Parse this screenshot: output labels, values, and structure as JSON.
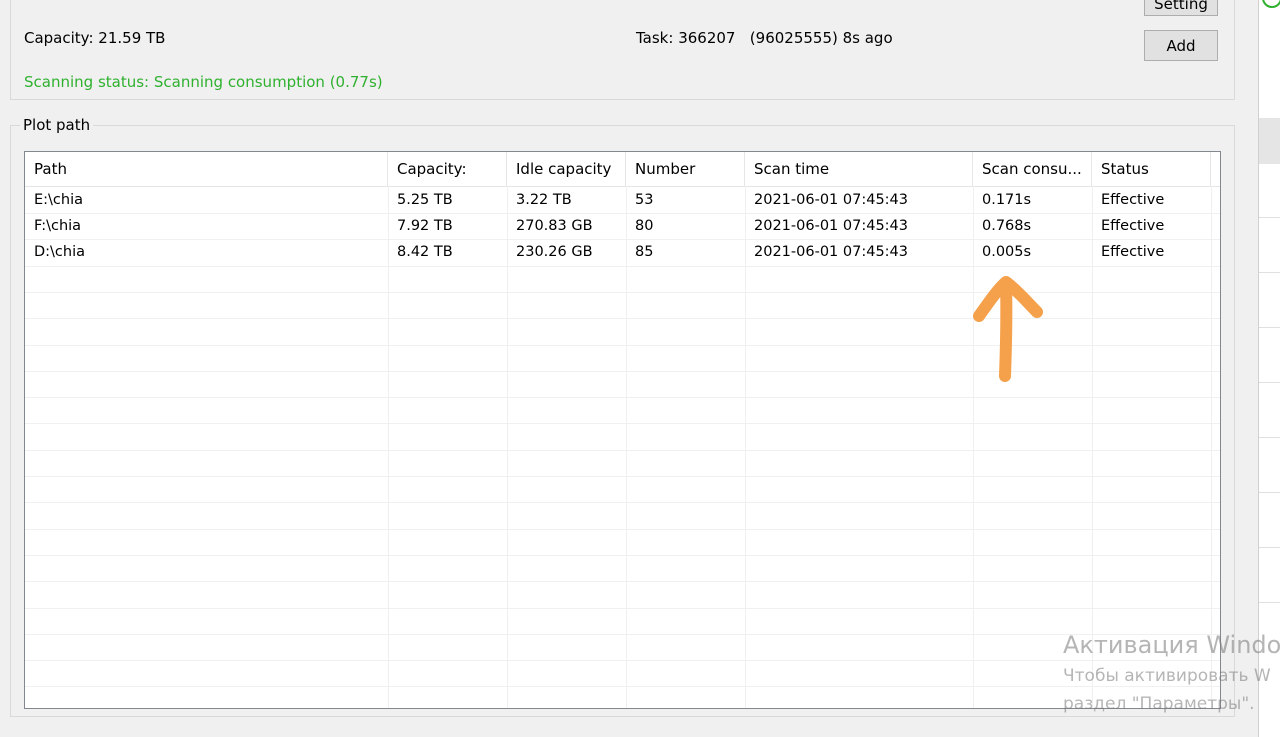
{
  "header": {
    "capacity_label": "Capacity:",
    "capacity_value": "21.59 TB",
    "task_label": "Task:",
    "task_value": "366207",
    "task_detail": "(96025555) 8s ago",
    "scan_status_label": "Scanning status:",
    "scan_status_value": "Scanning consumption (0.77s)",
    "status_color": "#2fb12f"
  },
  "buttons": {
    "setting_label": "Setting",
    "add_label": "Add"
  },
  "plot_path": {
    "group_title": "Plot path",
    "columns": [
      "Path",
      "Capacity:",
      "Idle capacity",
      "Number",
      "Scan time",
      "Scan consu...",
      "Status"
    ],
    "rows": [
      [
        "E:\\chia",
        "5.25 TB",
        "3.22 TB",
        "53",
        "2021-06-01 07:45:43",
        "0.171s",
        "Effective"
      ],
      [
        "F:\\chia",
        "7.92 TB",
        "270.83 GB",
        "80",
        "2021-06-01 07:45:43",
        "0.768s",
        "Effective"
      ],
      [
        "D:\\chia",
        "8.42 TB",
        "230.26 GB",
        "85",
        "2021-06-01 07:45:43",
        "0.005s",
        "Effective"
      ]
    ]
  },
  "annotation": {
    "arrow_color": "#f5a04a",
    "icon": "arrow-up-icon"
  },
  "watermark": {
    "title": "Активация Windo",
    "line1": "Чтобы активировать W",
    "line2": "раздел \"Параметры\"."
  }
}
